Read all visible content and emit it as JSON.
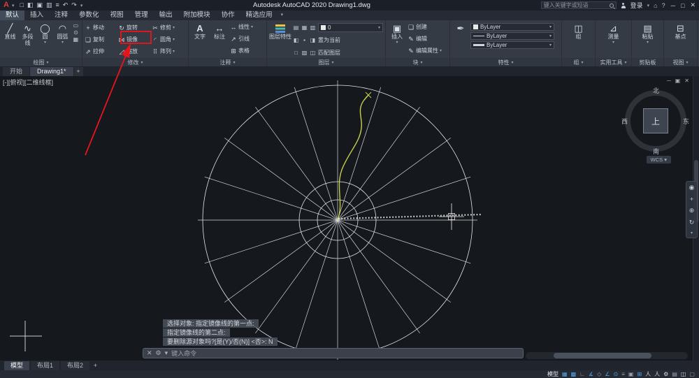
{
  "titlebar": {
    "logo": "A",
    "title": "Autodesk AutoCAD 2020   Drawing1.dwg",
    "search_placeholder": "键入关键字或短语",
    "signin": "登录"
  },
  "menu_tabs": [
    {
      "label": "默认"
    },
    {
      "label": "插入"
    },
    {
      "label": "注释"
    },
    {
      "label": "参数化"
    },
    {
      "label": "视图"
    },
    {
      "label": "管理"
    },
    {
      "label": "输出"
    },
    {
      "label": "附加模块"
    },
    {
      "label": "协作"
    },
    {
      "label": "精选应用"
    }
  ],
  "ribbon": {
    "draw": {
      "caption": "绘图",
      "line": "直线",
      "polyline": "多段线",
      "circle": "圆",
      "arc": "圆弧"
    },
    "modify": {
      "caption": "修改",
      "move": "移动",
      "rotate": "旋转",
      "trim": "修剪",
      "copy": "复制",
      "mirror": "镜像",
      "fillet": "圆角",
      "stretch": "拉伸",
      "scale": "缩放",
      "array": "阵列"
    },
    "annotation": {
      "caption": "注释",
      "text": "文字",
      "dimension": "标注",
      "linear": "线性",
      "leader": "引线",
      "table": "表格"
    },
    "layers": {
      "caption": "图层",
      "properties": "图层特性",
      "current_layer": "0",
      "set_current": "置为当前",
      "match_layer": "匹配图层"
    },
    "block": {
      "caption": "块",
      "insert": "插入",
      "create": "创建",
      "edit": "编辑",
      "edit_attr": "编辑属性"
    },
    "properties": {
      "caption": "特性",
      "color": "ByLayer",
      "linetype": "ByLayer",
      "lineweight": "ByLayer"
    },
    "groups": {
      "caption": "组",
      "group": "组"
    },
    "utilities": {
      "caption": "实用工具",
      "measure": "测量"
    },
    "clipboard": {
      "caption": "剪贴板",
      "paste": "粘贴"
    },
    "view": {
      "caption": "视图",
      "base": "基点"
    }
  },
  "file_tabs": [
    {
      "label": "开始"
    },
    {
      "label": "Drawing1*"
    }
  ],
  "viewport": {
    "label": "[-][俯视][二维线框]",
    "viewcube": {
      "north": "北",
      "south": "南",
      "west": "西",
      "east": "东",
      "top": "上",
      "wcs": "WCS ▾"
    }
  },
  "command": {
    "history": [
      {
        "text": "选择对象:  指定镜像线的第一点:"
      },
      {
        "text": "指定镜像线的第二点:"
      },
      {
        "text": "要删除源对象吗?[是(Y)/否(N)] <否>:  N"
      }
    ],
    "placeholder": "键入命令"
  },
  "layout_tabs": [
    {
      "label": "模型"
    },
    {
      "label": "布局1"
    },
    {
      "label": "布局2"
    }
  ],
  "statusbar": {
    "model": "模型",
    "icons": [
      {
        "name": "grid-icon",
        "glyph": "▦"
      },
      {
        "name": "snap-icon",
        "glyph": "▩"
      },
      {
        "name": "ortho-icon",
        "glyph": "∟"
      },
      {
        "name": "polar-tracking-icon",
        "glyph": "∡"
      },
      {
        "name": "isodraft-icon",
        "glyph": "◇"
      },
      {
        "name": "object-snap-tracking-icon",
        "glyph": "∠"
      },
      {
        "name": "object-snap-icon",
        "glyph": "⊙"
      },
      {
        "name": "lineweight-icon",
        "glyph": "≡"
      },
      {
        "name": "transparency-icon",
        "glyph": "▣"
      },
      {
        "name": "selection-cycling-icon",
        "glyph": "⊞"
      },
      {
        "name": "annotation-visibility-icon",
        "glyph": "人"
      },
      {
        "name": "autoscale-icon",
        "glyph": "人"
      },
      {
        "name": "workspace-icon",
        "glyph": "⚙"
      },
      {
        "name": "annotation-monitor-icon",
        "glyph": "▤"
      },
      {
        "name": "isolate-objects-icon",
        "glyph": "◫"
      },
      {
        "name": "clean-screen-icon",
        "glyph": "▢"
      }
    ]
  },
  "colors": {
    "accent_blue": "#4fa6e8",
    "annotation_red": "#e8151c",
    "spline_yellow": "#c9d24b",
    "canvas_bg": "#15181d"
  }
}
